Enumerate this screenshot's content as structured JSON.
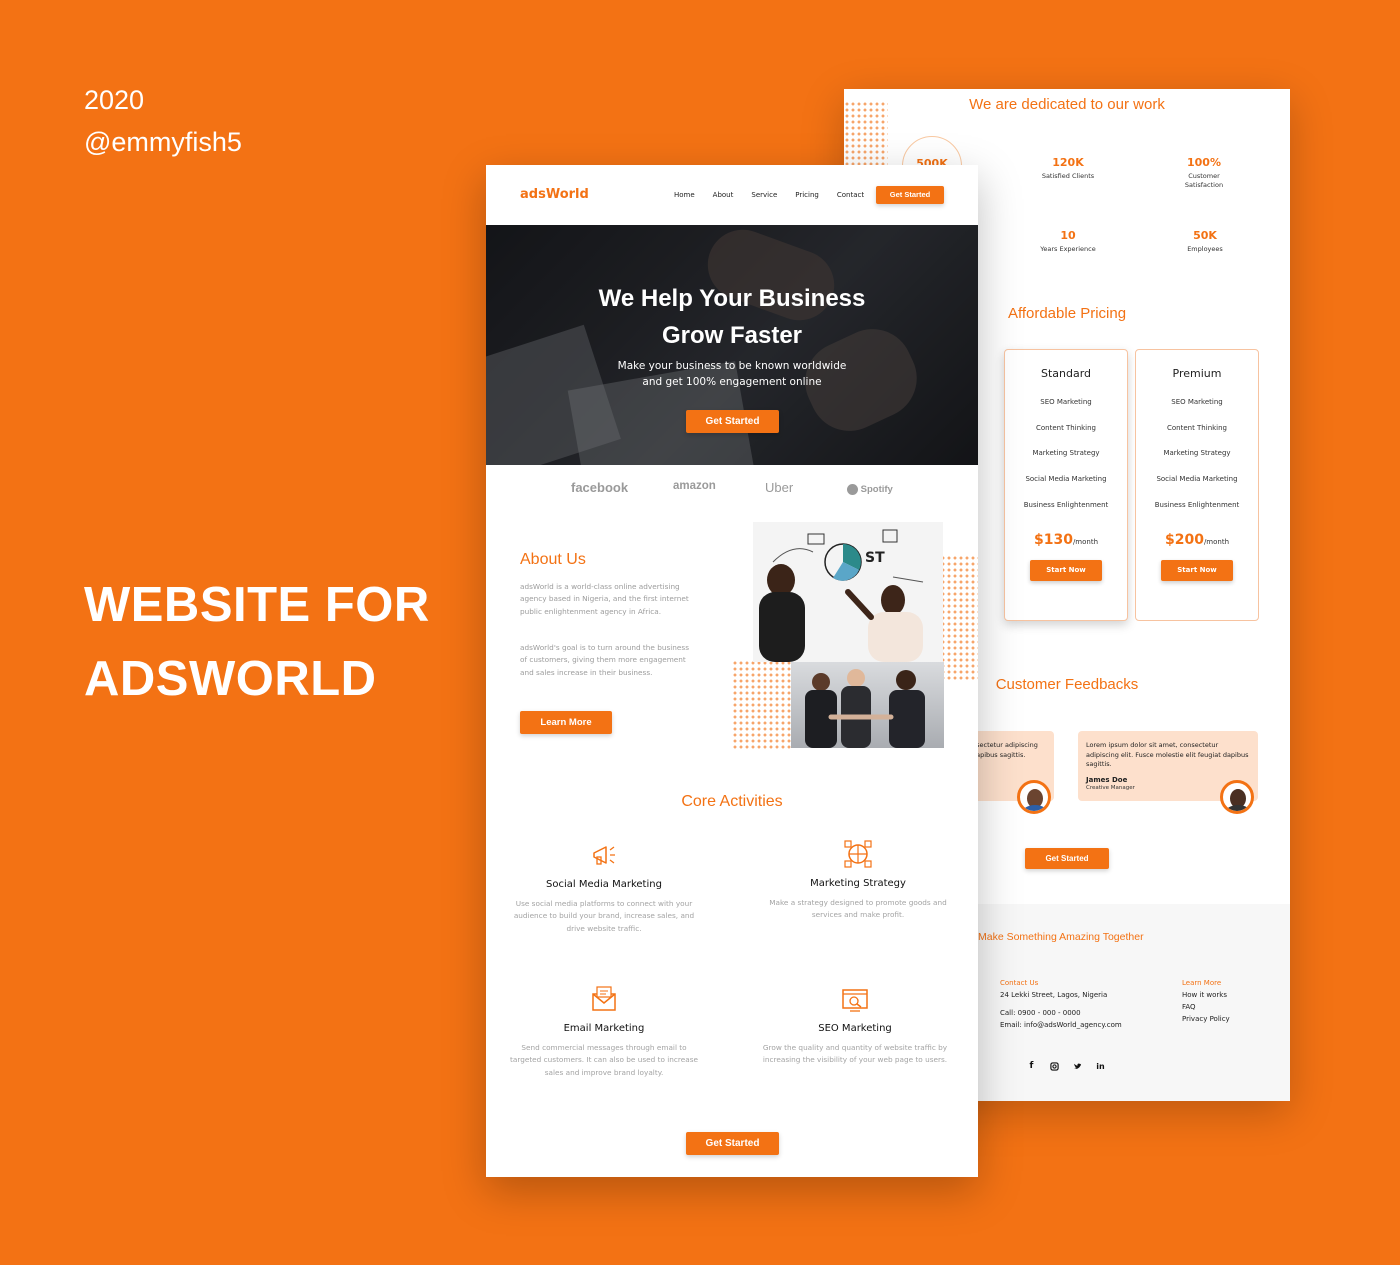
{
  "intro": {
    "year": "2020",
    "handle": "@emmyfish5",
    "title_line1": "WEBSITE FOR",
    "title_line2": "ADSWORLD"
  },
  "back_page": {
    "dedicated_heading": "We are dedicated to our work",
    "stats": [
      {
        "value": "500K",
        "label": ""
      },
      {
        "value": "120K",
        "label": "Satisfied Clients"
      },
      {
        "value": "100%",
        "label": "Customer Satisfaction"
      },
      {
        "value": "10",
        "label": "Years Experience"
      },
      {
        "value": "50K",
        "label": "Employees"
      }
    ],
    "pricing_heading": "Affordable Pricing",
    "plans": [
      {
        "name": "Standard",
        "features": [
          "SEO Marketing",
          "Content Thinking",
          "Marketing Strategy",
          "Social Media Marketing",
          "Business Enlightenment"
        ],
        "price": "$130",
        "period": "/month",
        "button": "Start Now"
      },
      {
        "name": "Premium",
        "features": [
          "SEO Marketing",
          "Content Thinking",
          "Marketing Strategy",
          "Social Media Marketing",
          "Business Enlightenment"
        ],
        "price": "$200",
        "period": "/month",
        "button": "Start Now"
      }
    ],
    "feedback_heading": "Customer Feedbacks",
    "feedbacks": [
      {
        "text": "nsectetur adipiscing dapibus sagittis.",
        "name": "",
        "role": ""
      },
      {
        "text": "Lorem ipsum dolor sit amet, consectetur adipiscing elit. Fusce molestie elit feugiat dapibus sagittis.",
        "name": "James Doe",
        "role": "Creative Manager"
      }
    ],
    "feedback_button": "Get Started",
    "footer": {
      "tagline": "Make Something Amazing Together",
      "contact_heading": "Contact Us",
      "address": "24 Lekki Street, Lagos, Nigeria",
      "call": "Call: 0900 - 000 - 0000",
      "email": "Email: info@adsWorld_agency.com",
      "learn_heading": "Learn More",
      "links": [
        "How it works",
        "FAQ",
        "Privacy Policy"
      ],
      "social_icons": [
        "facebook-icon",
        "instagram-icon",
        "twitter-icon",
        "linkedin-icon"
      ]
    }
  },
  "front_page": {
    "logo": "adsWorld",
    "nav": [
      "Home",
      "About",
      "Service",
      "Pricing",
      "Contact"
    ],
    "nav_button": "Get Started",
    "hero": {
      "title_line1": "We Help Your Business",
      "title_line2": "Grow Faster",
      "subtitle_line1": "Make your business to be known worldwide",
      "subtitle_line2": "and get 100% engagement online",
      "button": "Get Started"
    },
    "brands": [
      "facebook",
      "amazon",
      "Uber",
      "Spotify"
    ],
    "about": {
      "title": "About Us",
      "p1": "adsWorld is a world-class online advertising agency based in Nigeria, and the first internet public enlightenment agency in Africa.",
      "p2": "adsWorld's goal is to turn around the business of customers, giving them more engagement and sales increase in their business.",
      "button": "Learn More"
    },
    "core": {
      "title": "Core Activities",
      "items": [
        {
          "name": "Social Media Marketing",
          "desc": "Use social media platforms to connect with your audience to build your brand, increase sales, and drive website traffic.",
          "icon": "megaphone-icon"
        },
        {
          "name": "Marketing Strategy",
          "desc": "Make a strategy designed to promote goods and services and make profit.",
          "icon": "strategy-icon"
        },
        {
          "name": "Email Marketing",
          "desc": "Send commercial messages through email to targeted customers. It can also be used to increase sales and improve brand loyalty.",
          "icon": "email-icon"
        },
        {
          "name": "SEO Marketing",
          "desc": "Grow the quality and quantity of website traffic by increasing the visibility of your web page to users.",
          "icon": "seo-icon"
        }
      ],
      "button": "Get Started"
    }
  },
  "colors": {
    "accent": "#f37214",
    "light_accent": "#fde0cc",
    "text_muted": "#9c9c9c"
  }
}
